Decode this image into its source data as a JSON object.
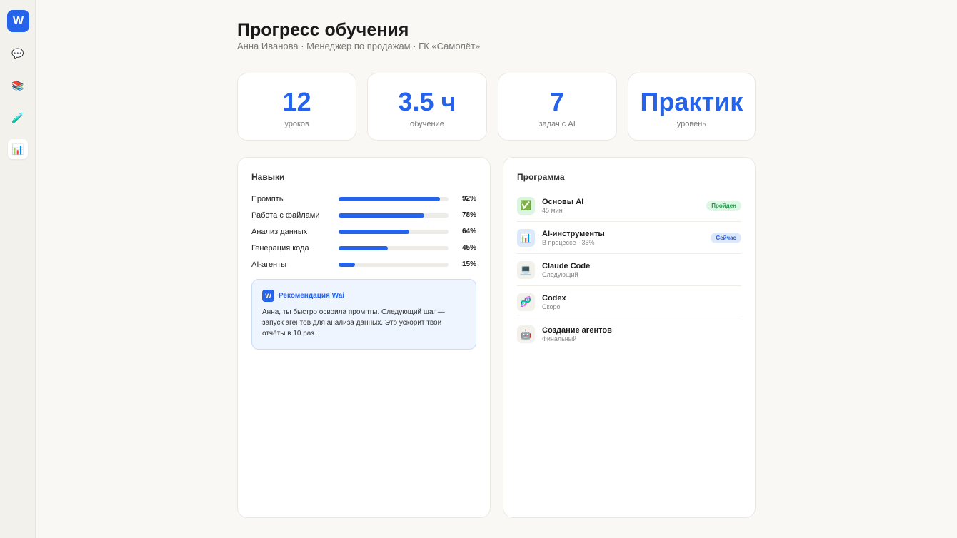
{
  "sidebar": {
    "logo": "W",
    "items": [
      {
        "icon": "💬",
        "name": "chat"
      },
      {
        "icon": "📚",
        "name": "courses"
      },
      {
        "icon": "🧪",
        "name": "practice"
      },
      {
        "icon": "📊",
        "name": "progress"
      }
    ]
  },
  "header": {
    "title": "Прогресс обучения",
    "subtitle": "Анна Иванова · Менеджер по продажам · ГК «Самолёт»"
  },
  "stats": [
    {
      "value": "12",
      "label": "уроков"
    },
    {
      "value": "3.5 ч",
      "label": "обучение"
    },
    {
      "value": "7",
      "label": "задач с AI"
    },
    {
      "value": "Практик",
      "label": "уровень"
    }
  ],
  "skills": {
    "title": "Навыки",
    "items": [
      {
        "name": "Промпты",
        "percent": 92,
        "label": "92%"
      },
      {
        "name": "Работа с файлами",
        "percent": 78,
        "label": "78%"
      },
      {
        "name": "Анализ данных",
        "percent": 64,
        "label": "64%"
      },
      {
        "name": "Генерация кода",
        "percent": 45,
        "label": "45%"
      },
      {
        "name": "AI-агенты",
        "percent": 15,
        "label": "15%"
      }
    ]
  },
  "recommendation": {
    "icon": "W",
    "title": "Рекомендация Wai",
    "text": "Анна, ты быстро освоила промпты. Следующий шаг — запуск агентов для анализа данных. Это ускорит твои отчёты в 10 раз."
  },
  "program": {
    "title": "Программа",
    "items": [
      {
        "icon": "✅",
        "title": "Основы AI",
        "sub": "45 мин",
        "badge": "Пройден",
        "iconBg": "#dcf5e3",
        "badgeBg": "#dcf7e4",
        "badgeColor": "#1f9d4c"
      },
      {
        "icon": "📊",
        "title": "AI-инструменты",
        "sub": "В процессе · 35%",
        "badge": "Сейчас",
        "iconBg": "#dde9fb",
        "badgeBg": "#dde9fb",
        "badgeColor": "#2563eb"
      },
      {
        "icon": "💻",
        "title": "Claude Code",
        "sub": "Следующий"
      },
      {
        "icon": "🧬",
        "title": "Codex",
        "sub": "Скоро"
      },
      {
        "icon": "🤖",
        "title": "Создание агентов",
        "sub": "Финальный"
      }
    ]
  }
}
